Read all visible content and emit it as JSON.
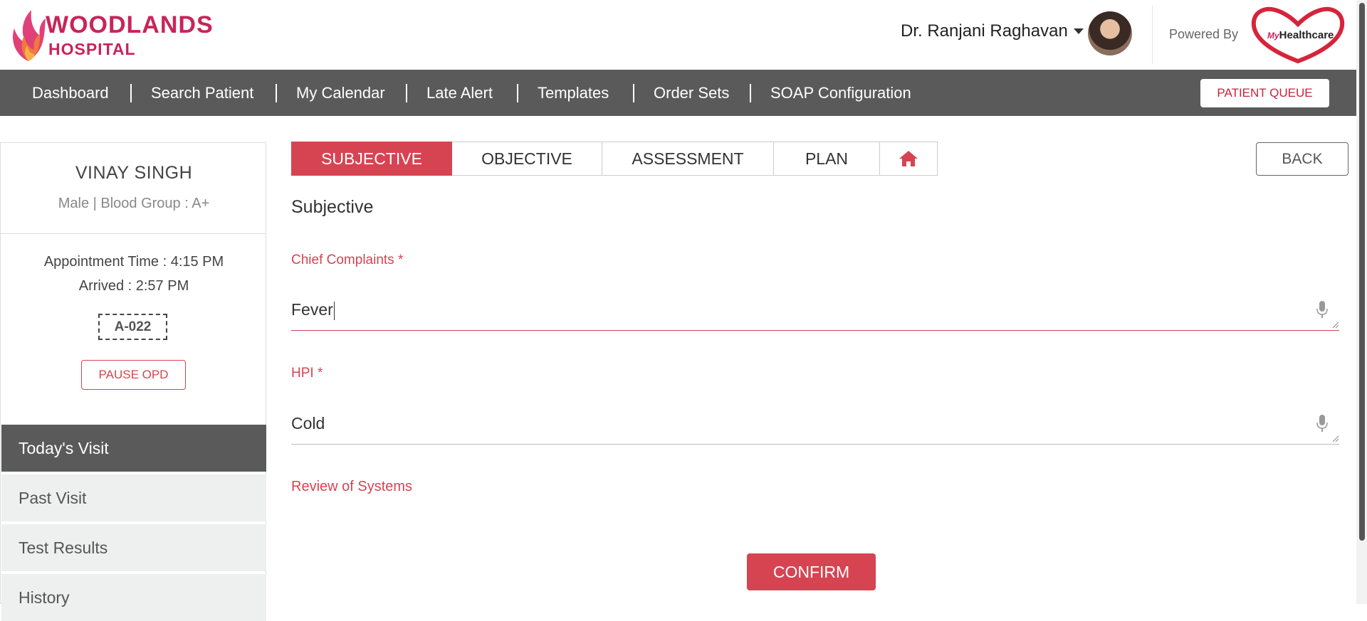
{
  "header": {
    "logo_line1": "WOODLANDS",
    "logo_line2": "HOSPITAL",
    "user_name": "Dr. Ranjani Raghavan",
    "powered_by": "Powered By",
    "partner_logo_my": "My",
    "partner_logo_name": "Healthcare"
  },
  "nav": {
    "items": [
      "Dashboard",
      "Search Patient",
      "My Calendar",
      "Late Alert",
      "Templates",
      "Order Sets",
      "SOAP Configuration"
    ],
    "patient_queue": "PATIENT QUEUE"
  },
  "patient": {
    "name": "VINAY SINGH",
    "details": "Male | Blood Group : A+",
    "appointment": "Appointment Time : 4:15 PM",
    "arrived": "Arrived : 2:57 PM",
    "token": "A-022",
    "pause_button": "PAUSE OPD"
  },
  "sidebar": {
    "items": [
      "Today's Visit",
      "Past Visit",
      "Test Results",
      "History"
    ],
    "active": "Today's Visit"
  },
  "tabs": {
    "items": [
      "SUBJECTIVE",
      "OBJECTIVE",
      "ASSESSMENT",
      "PLAN"
    ],
    "active": "SUBJECTIVE",
    "home_icon": "home-icon"
  },
  "back_button": "BACK",
  "form": {
    "section_title": "Subjective",
    "chief_complaints_label": "Chief Complaints *",
    "chief_complaints_value": "Fever",
    "hpi_label": "HPI *",
    "hpi_value": "Cold",
    "review_of_systems": "Review of Systems",
    "confirm": "CONFIRM"
  },
  "colors": {
    "brand": "#c8245a",
    "accent": "#d64452",
    "nav_bg": "#5a5a5a"
  }
}
